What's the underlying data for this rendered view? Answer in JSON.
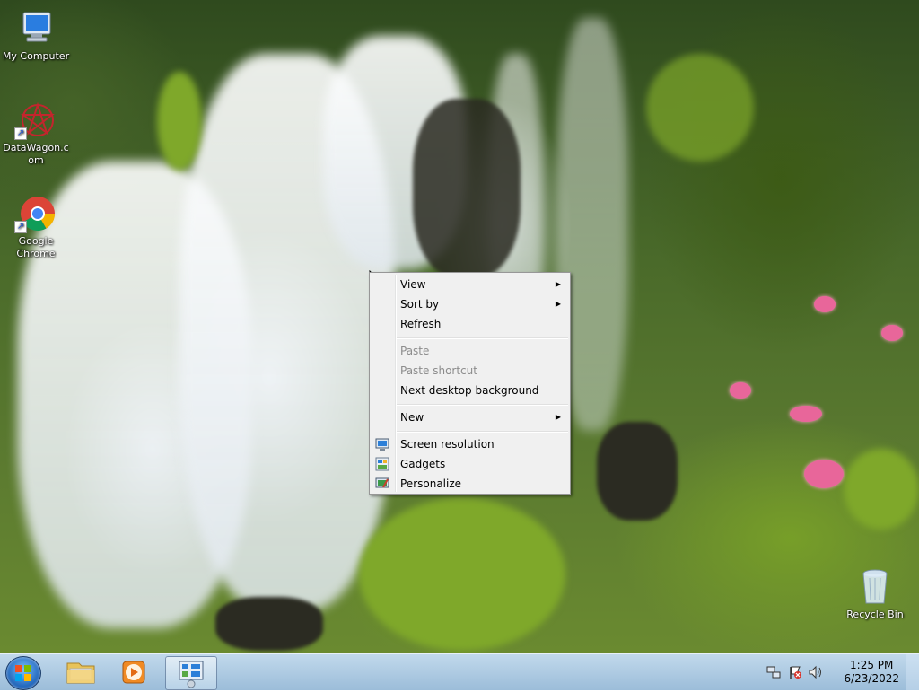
{
  "desktop": {
    "icons": [
      {
        "label": "My Computer",
        "icon": "computer-icon"
      },
      {
        "label": "DataWagon.c om",
        "icon": "datawagon-icon"
      },
      {
        "label": "Google Chrome",
        "icon": "chrome-icon"
      },
      {
        "label": "Recycle Bin",
        "icon": "recycle-bin-icon"
      }
    ]
  },
  "context_menu": {
    "items": [
      {
        "label": "View",
        "has_submenu": true,
        "enabled": true
      },
      {
        "label": "Sort by",
        "has_submenu": true,
        "enabled": true
      },
      {
        "label": "Refresh",
        "enabled": true
      },
      {
        "label": "Paste",
        "enabled": false
      },
      {
        "label": "Paste shortcut",
        "enabled": false
      },
      {
        "label": "Next desktop background",
        "enabled": true
      },
      {
        "label": "New",
        "has_submenu": true,
        "enabled": true
      },
      {
        "label": "Screen resolution",
        "icon": "screen-resolution-icon",
        "enabled": true
      },
      {
        "label": "Gadgets",
        "icon": "gadgets-icon",
        "enabled": true
      },
      {
        "label": "Personalize",
        "icon": "personalize-icon",
        "enabled": true
      }
    ],
    "submenu_arrow": "▶"
  },
  "taskbar": {
    "items": [
      {
        "icon": "start-orb-icon"
      },
      {
        "icon": "windows-explorer-icon"
      },
      {
        "icon": "media-player-icon"
      },
      {
        "icon": "control-panel-icon",
        "active": true
      }
    ],
    "tray": {
      "icons": [
        "network-icon",
        "action-center-icon",
        "volume-icon"
      ],
      "time": "1:25 PM",
      "date": "6/23/2022"
    }
  }
}
